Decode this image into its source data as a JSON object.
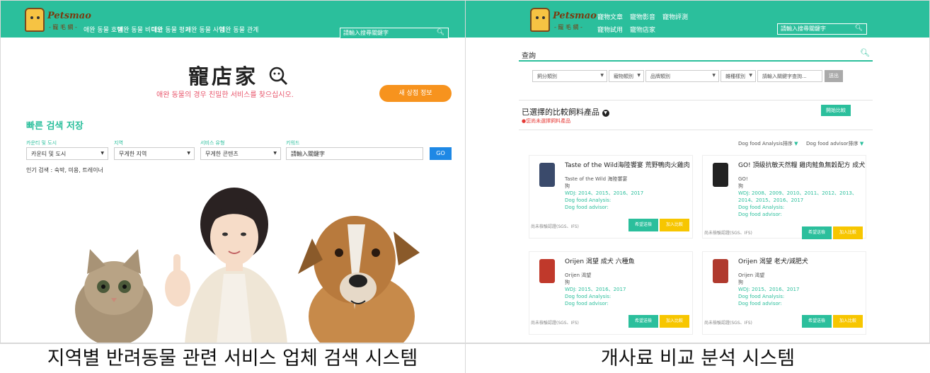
{
  "left": {
    "logo": {
      "name": "Petsmao",
      "sub": "- 寵 毛 網 -"
    },
    "nav": [
      "애완 동물 호텔",
      "애완 동물 비디오",
      "애완 동물 평가",
      "애완 동물 사업",
      "애완 동물 관계"
    ],
    "search_placeholder": "請輸入搜尋關鍵字",
    "brand_title": "寵店家",
    "tagline": "애완 동물의 경우 친밀한 서비스를 찾으십시오.",
    "new_store_button": "새 상점 정보",
    "quick_search_title": "빠른 검색 저장",
    "filters": [
      {
        "label": "카운티 및 도시",
        "value": "카운티 및 도시"
      },
      {
        "label": "지역",
        "value": "무게한 지역"
      },
      {
        "label": "서비스 유형",
        "value": "무게한 콘텐츠"
      },
      {
        "label": "키워드",
        "value": "請輸入關鍵字"
      }
    ],
    "go_button": "GO",
    "popular": "인기 검색 : 숙박, 미용, 트레이너"
  },
  "right": {
    "logo": {
      "name": "Petsmao",
      "sub": "- 寵 毛 網 -"
    },
    "nav_row1": [
      "寵物文章",
      "寵物影音",
      "寵物評測"
    ],
    "nav_row2": [
      "寵物試用",
      "寵物店家"
    ],
    "search_placeholder": "請輸入搜尋關鍵字",
    "query_label": "查詢",
    "filters": [
      "飼分類別",
      "寵物類別",
      "品牌類別",
      "雜種樣別",
      "請輸入關鍵字查詢..."
    ],
    "send_button": "送出",
    "compare_title": "已選擇的比較飼料產品",
    "compare_note": "您尚未選擇飼料產品",
    "start_compare_button": "開始比較",
    "sort_analysis": "Dog food Analysis排序",
    "sort_advisor": "Dog food advisor排序",
    "cards": [
      {
        "title": "Taste of the Wild海陸饗宴 荒野鴨肉火雞肉",
        "brand": "Taste of the Wild 海陸饗宴",
        "kind": "狗",
        "wdj": "WDJ: 2014、2015、2016、2017",
        "analysis": "Dog food Analysis:",
        "advisor": "Dog food advisor:",
        "cert": "尚未檢驗認證(SGS、IFS)",
        "btn1": "希望送檢",
        "btn2": "加入比較",
        "color": "#3a4a6b"
      },
      {
        "title": "GO! 頂級抗敏天然糧 雞肉鮭魚無穀配方 成犬",
        "brand": "GO!",
        "kind": "狗",
        "wdj": "WDJ: 2008、2009、2010、2011、2012、2013、2014、2015、2016、2017",
        "analysis": "Dog food Analysis:",
        "advisor": "Dog food advisor:",
        "cert": "尚未檢驗認證(SGS、IFS)",
        "btn1": "希望送檢",
        "btn2": "加入比較",
        "color": "#222222"
      },
      {
        "title": "Orijen 渴望 成犬 六種魚",
        "brand": "Orijen 渴望",
        "kind": "狗",
        "wdj": "WDJ: 2015、2016、2017",
        "analysis": "Dog food Analysis:",
        "advisor": "Dog food advisor:",
        "cert": "尚未檢驗認證(SGS、IFS)",
        "btn1": "希望送檢",
        "btn2": "加入比較",
        "color": "#c0392b"
      },
      {
        "title": "Orijen 渴望 老犬/減肥犬",
        "brand": "Orijen 渴望",
        "kind": "狗",
        "wdj": "WDJ: 2015、2016、2017",
        "analysis": "Dog food Analysis:",
        "advisor": "Dog food advisor:",
        "cert": "尚未檢驗認證(SGS、IFS)",
        "btn1": "希望送檢",
        "btn2": "加入比較",
        "color": "#b03a2e"
      }
    ]
  },
  "captions": {
    "left": "지역별 반려동물 관련 서비스 업체 검색 시스템",
    "right": "개사료 비교 분석 시스템"
  },
  "colors": {
    "brand_green": "#2bbf9c",
    "orange": "#f7931e",
    "pink": "#e8556b",
    "go_blue": "#1e88e5",
    "yellow": "#f7c600"
  }
}
